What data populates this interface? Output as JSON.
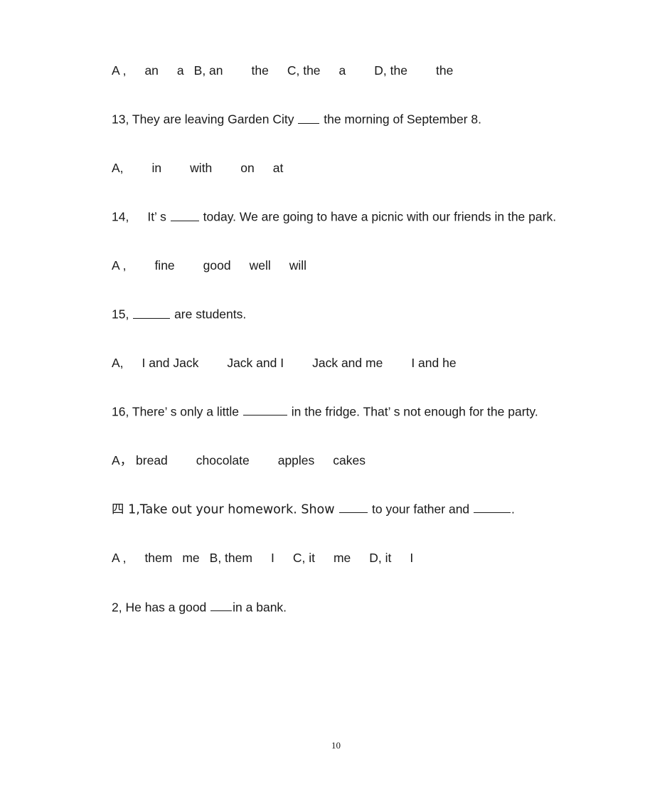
{
  "document": {
    "page_number": "10",
    "text_color": "#1a1a1a",
    "background_color": "#ffffff"
  },
  "blocks": [
    {
      "id": "options-12",
      "kind": "options",
      "segments": [
        {
          "text": "A ,"
        },
        {
          "gap": "m"
        },
        {
          "text": "an"
        },
        {
          "gap": "m"
        },
        {
          "text": "a"
        },
        {
          "gap": "s"
        },
        {
          "text": "B, an"
        },
        {
          "gap": "l"
        },
        {
          "text": "the"
        },
        {
          "gap": "m"
        },
        {
          "text": "C, the"
        },
        {
          "gap": "m"
        },
        {
          "text": "a"
        },
        {
          "gap": "l"
        },
        {
          "text": "D, the"
        },
        {
          "gap": "l"
        },
        {
          "text": "the"
        }
      ],
      "plain": "A ,   an   a  B, an    the   C, the   a    D, the    the"
    },
    {
      "id": "question-13",
      "kind": "question",
      "segments": [
        {
          "text": "13, They are leaving Garden City "
        },
        {
          "blank": "w3"
        },
        {
          "text": " the morning of September 8."
        }
      ],
      "plain": "13, They are leaving Garden City ___ the morning of September 8."
    },
    {
      "id": "options-13",
      "kind": "options",
      "segments": [
        {
          "text": "A,"
        },
        {
          "gap": "l"
        },
        {
          "text": "in"
        },
        {
          "gap": "l"
        },
        {
          "text": "with"
        },
        {
          "gap": "l"
        },
        {
          "text": "on"
        },
        {
          "gap": "m"
        },
        {
          "text": "at"
        }
      ],
      "plain": "A,    in      with     on    at"
    },
    {
      "id": "question-14",
      "kind": "question",
      "justified": true,
      "segments": [
        {
          "text": "14,"
        },
        {
          "gap": "m"
        },
        {
          "text": "It’ s "
        },
        {
          "blank": "w4"
        },
        {
          "text": " today. We are going to have a picnic with our friends in the park."
        }
      ],
      "plain": "14,    It’ s ____ today. We are going to have a picnic with our friends in the park."
    },
    {
      "id": "options-14",
      "kind": "options",
      "segments": [
        {
          "text": "A ,"
        },
        {
          "gap": "l"
        },
        {
          "text": "fine"
        },
        {
          "gap": "l"
        },
        {
          "text": "good"
        },
        {
          "gap": "m"
        },
        {
          "text": "well"
        },
        {
          "gap": "m"
        },
        {
          "text": "will"
        }
      ],
      "plain": "A ,    fine      good    well     will"
    },
    {
      "id": "question-15",
      "kind": "question",
      "segments": [
        {
          "text": "15, "
        },
        {
          "blank": "w5"
        },
        {
          "text": " are students."
        }
      ],
      "plain": "15, _____ are students."
    },
    {
      "id": "options-15",
      "kind": "options",
      "segments": [
        {
          "text": "A,"
        },
        {
          "gap": "m"
        },
        {
          "text": "I and Jack"
        },
        {
          "gap": "l"
        },
        {
          "text": "Jack and I"
        },
        {
          "gap": "l"
        },
        {
          "text": "Jack and me"
        },
        {
          "gap": "l"
        },
        {
          "text": "I and he"
        }
      ],
      "plain": "A,   I and Jack      Jack and I     Jack and me     I and he"
    },
    {
      "id": "question-16",
      "kind": "question",
      "justified": true,
      "segments": [
        {
          "text": "16, There’ s only a little "
        },
        {
          "blank": "w6"
        },
        {
          "text": " in the fridge. That’ s not enough for the party."
        }
      ],
      "plain": "16, There’ s only a little ______ in the fridge. That’ s not enough for the party."
    },
    {
      "id": "options-16",
      "kind": "options",
      "segments": [
        {
          "text": "A， bread"
        },
        {
          "gap": "l"
        },
        {
          "text": "chocolate"
        },
        {
          "gap": "l"
        },
        {
          "text": "apples"
        },
        {
          "gap": "m"
        },
        {
          "text": "cakes"
        }
      ],
      "plain": "A， bread     chocolate     apples    cakes"
    },
    {
      "id": "question-four-1",
      "kind": "question",
      "segments": [
        {
          "text": "四 1,Take out your homework. Show ",
          "cjk_lead": true
        },
        {
          "blank": "w4"
        },
        {
          "text": " to your father and "
        },
        {
          "blank": "w5"
        },
        {
          "text": "."
        }
      ],
      "plain": "四 1,Take out your homework. Show ____ to your father and _____."
    },
    {
      "id": "options-four-1",
      "kind": "options",
      "segments": [
        {
          "text": "A ,"
        },
        {
          "gap": "m"
        },
        {
          "text": "them"
        },
        {
          "gap": "s"
        },
        {
          "text": "me"
        },
        {
          "gap": "s"
        },
        {
          "text": "B, them"
        },
        {
          "gap": "m"
        },
        {
          "text": "I"
        },
        {
          "gap": "m"
        },
        {
          "text": "C, it"
        },
        {
          "gap": "m"
        },
        {
          "text": "me"
        },
        {
          "gap": "m"
        },
        {
          "text": "D, it"
        },
        {
          "gap": "m"
        },
        {
          "text": "I"
        }
      ],
      "plain": "A ,  them  me  B, them   I   C, it   me   D, it   I"
    },
    {
      "id": "question-four-2",
      "kind": "question",
      "segments": [
        {
          "text": "2, He has a good "
        },
        {
          "blank": "w3"
        },
        {
          "text": "in a bank."
        }
      ],
      "plain": "2, He has a good ___in a bank."
    }
  ]
}
